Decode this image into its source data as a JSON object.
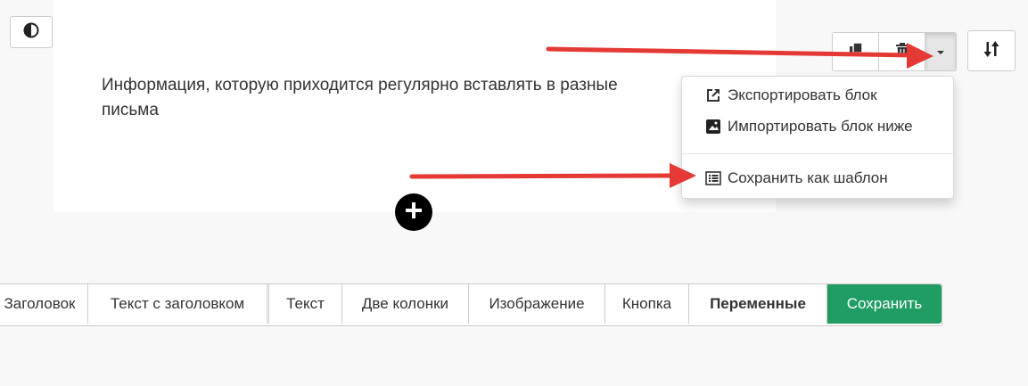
{
  "block": {
    "text_line1": "Информация, которую приходится регулярно вставлять в разные",
    "text_line2": "письма"
  },
  "icons": {
    "contrast": "contrast-icon",
    "copy": "copy-icon",
    "trash": "trash-icon",
    "caret": "caret-down-icon",
    "sort": "sort-icon",
    "add": "plus-circle-icon",
    "export": "external-link-icon",
    "import": "image-icon",
    "template": "list-icon"
  },
  "dropdown": {
    "export_label": "Экспортировать блок",
    "import_label": "Импортировать блок ниже",
    "save_template_label": "Сохранить как шаблон"
  },
  "toolbar": {
    "items": [
      "Заголовок",
      "Текст с заголовком",
      "Текст",
      "Две колонки",
      "Изображение",
      "Кнопка",
      "Переменные",
      "Сохранить"
    ]
  },
  "colors": {
    "save_button": "#1f9d63",
    "arrow": "#e53935",
    "page_background": "#f8f8f8"
  }
}
